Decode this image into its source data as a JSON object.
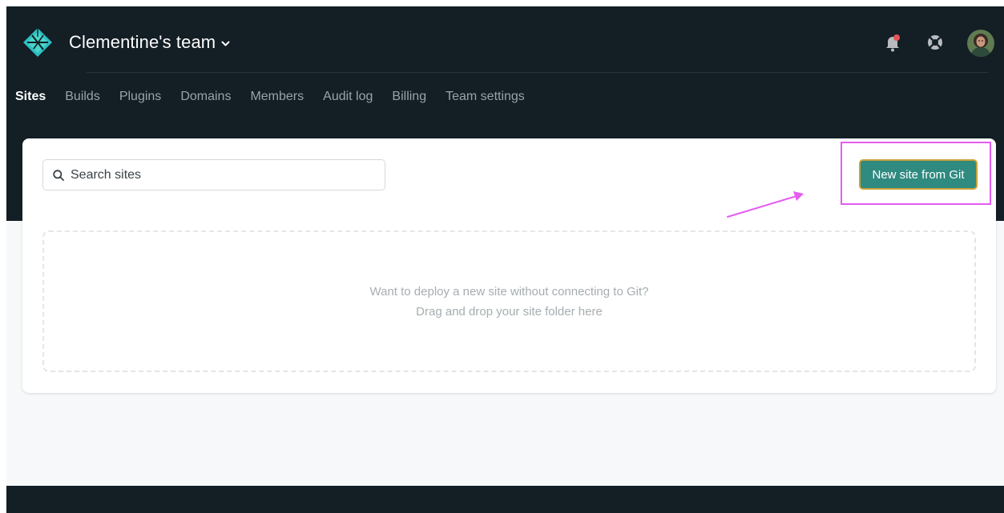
{
  "header": {
    "team_name": "Clementine's team",
    "icons": {
      "logo": "netlify-logo-icon",
      "chevron": "chevron-down-icon",
      "notifications": "bell-icon",
      "help": "lifebuoy-icon",
      "avatar": "user-avatar"
    },
    "notification_dot_color": "#e45459"
  },
  "nav": {
    "tabs": [
      {
        "label": "Sites",
        "active": true
      },
      {
        "label": "Builds"
      },
      {
        "label": "Plugins"
      },
      {
        "label": "Domains"
      },
      {
        "label": "Members"
      },
      {
        "label": "Audit log"
      },
      {
        "label": "Billing"
      },
      {
        "label": "Team settings"
      }
    ]
  },
  "main": {
    "search": {
      "placeholder": "Search sites",
      "value": ""
    },
    "new_site_button": "New site from Git",
    "dropzone": {
      "line1": "Want to deploy a new site without connecting to Git?",
      "line2": "Drag and drop your site folder here"
    }
  },
  "colors": {
    "header_bg": "#131e25",
    "accent_button": "#2f8a80",
    "annotation": "#e45cf0"
  }
}
